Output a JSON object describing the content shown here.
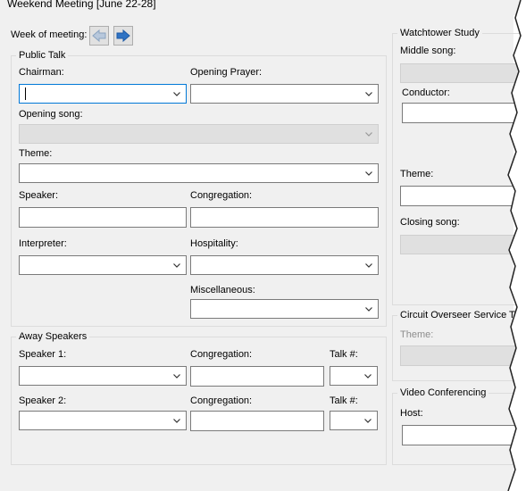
{
  "window": {
    "title": "Weekend Meeting [June 22-28]"
  },
  "week": {
    "label": "Week of meeting:",
    "prev_icon": "arrow-left-icon",
    "next_icon": "arrow-right-icon"
  },
  "public_talk": {
    "legend": "Public Talk",
    "chairman_label": "Chairman:",
    "opening_prayer_label": "Opening Prayer:",
    "opening_song_label": "Opening song:",
    "theme_label": "Theme:",
    "speaker_label": "Speaker:",
    "congregation_label": "Congregation:",
    "interpreter_label": "Interpreter:",
    "hospitality_label": "Hospitality:",
    "miscellaneous_label": "Miscellaneous:"
  },
  "away_speakers": {
    "legend": "Away Speakers",
    "speaker1_label": "Speaker 1:",
    "speaker2_label": "Speaker 2:",
    "congregation_label": "Congregation:",
    "talk_label": "Talk #:"
  },
  "watchtower": {
    "legend": "Watchtower Study",
    "middle_song_label": "Middle song:",
    "conductor_label": "Conductor:",
    "theme_label": "Theme:",
    "closing_song_label": "Closing song:"
  },
  "circuit_overseer": {
    "legend": "Circuit Overseer Service Ta",
    "theme_label": "Theme:"
  },
  "video_conferencing": {
    "legend": "Video Conferencing",
    "host_label": "Host:"
  },
  "colors": {
    "panel": "#f0f0f0",
    "border": "#7a7a7a",
    "focus": "#0078d7",
    "disabled": "#e0e0e0",
    "arrow": "#2f73c4"
  }
}
